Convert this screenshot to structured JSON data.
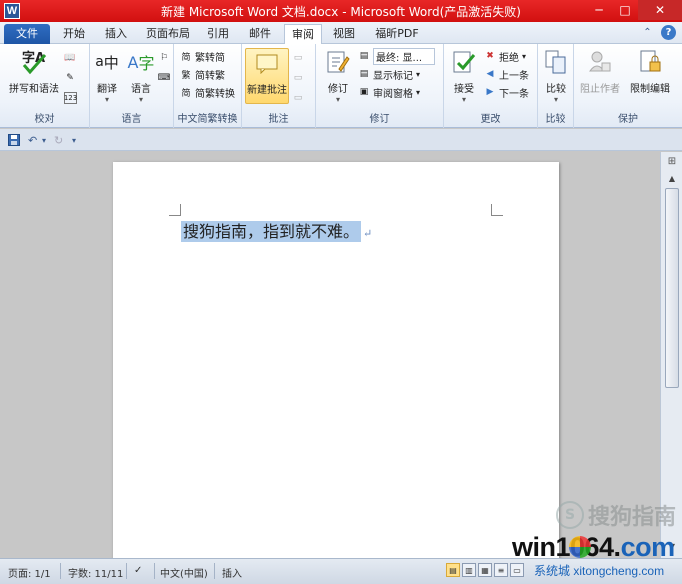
{
  "window": {
    "app_icon_letter": "W",
    "title": "新建 Microsoft Word 文档.docx - Microsoft Word(产品激活失败)",
    "minimize": "─",
    "maximize": "□",
    "close": "✕"
  },
  "tabs": [
    {
      "label": "文件",
      "active": false,
      "file": true
    },
    {
      "label": "开始",
      "active": false
    },
    {
      "label": "插入",
      "active": false
    },
    {
      "label": "页面布局",
      "active": false
    },
    {
      "label": "引用",
      "active": false
    },
    {
      "label": "邮件",
      "active": false
    },
    {
      "label": "审阅",
      "active": true
    },
    {
      "label": "视图",
      "active": false
    },
    {
      "label": "福昕PDF",
      "active": false
    }
  ],
  "ribbon": {
    "proofing": {
      "label": "校对",
      "spelling": "拼写和语法",
      "spelling_glyph": "字A"
    },
    "language": {
      "label": "语言",
      "translate": "翻译",
      "language": "语言"
    },
    "chinese_conversion": {
      "label": "中文简繁转换",
      "to_traditional": "繁转简",
      "to_simplified": "简转繁",
      "convert": "简繁转换"
    },
    "comments": {
      "label": "批注",
      "new_comment": "新建批注"
    },
    "tracking": {
      "label": "修订",
      "track_changes": "修订",
      "final_display": "最终: 显...",
      "show_markup": "显示标记",
      "reviewing_pane": "审阅窗格"
    },
    "changes": {
      "label": "更改",
      "accept": "接受",
      "reject": "拒绝",
      "previous": "上一条",
      "next": "下一条"
    },
    "compare": {
      "label": "比较",
      "compare": "比较"
    },
    "protect": {
      "label": "保护",
      "block_authors": "阻止作者",
      "restrict_editing": "限制编辑"
    }
  },
  "document": {
    "text": "搜狗指南，指到就不难。",
    "paragraph_mark": "↵"
  },
  "statusbar": {
    "page": "页面: 1/1",
    "words": "字数: 11/11",
    "language": "中文(中国)",
    "mode": "插入"
  },
  "watermarks": {
    "sogou_letter": "S",
    "sogou": "搜狗指南",
    "site_pre": "win1064.",
    "site_mid": "com",
    "site_brand": "系统城",
    "site_sub": "xitongcheng.com"
  },
  "colors": {
    "titlebar": "#d10f0f",
    "file_tab": "#1f56a6",
    "selection": "#aecbeb",
    "highlight": "#ffd86e"
  }
}
